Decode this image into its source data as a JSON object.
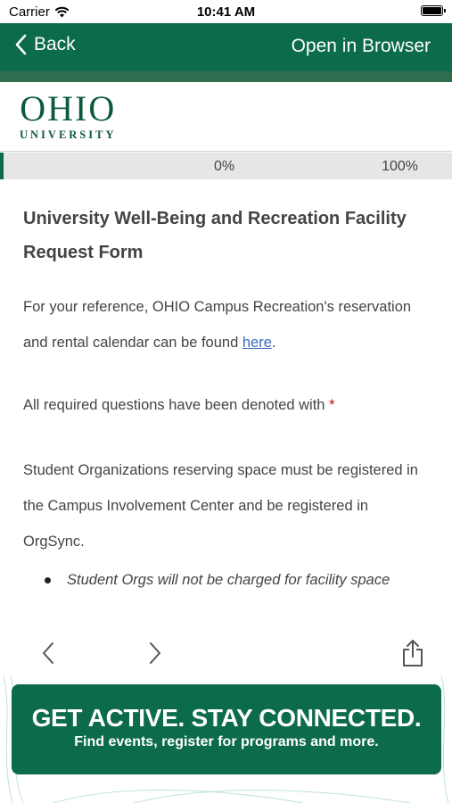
{
  "status": {
    "carrier": "Carrier",
    "time": "10:41 AM"
  },
  "nav": {
    "back_label": "Back",
    "open_browser_label": "Open in Browser"
  },
  "logo": {
    "main": "OHIO",
    "sub": "UNIVERSITY"
  },
  "progress": {
    "start_label": "0%",
    "end_label": "100%",
    "value": 0
  },
  "content": {
    "title": "University Well-Being and Recreation Facility Request Form",
    "reference_text": "For your reference, OHIO Campus Recreation's reservation and rental calendar can be found ",
    "reference_link": "here",
    "reference_end": ".",
    "required_text": "All required questions have been denoted with ",
    "required_mark": "*",
    "student_orgs_text": "Student Organizations reserving space must be registered in the Campus Involvement Center and be registered in OrgSync.",
    "bullet_text": "Student Orgs will not be charged for facility space"
  },
  "banner": {
    "title": "GET ACTIVE.  STAY CONNECTED.",
    "subtitle": "Find events, register for programs and more."
  },
  "colors": {
    "brand_green": "#0c6b4a",
    "link": "#3a6cc0",
    "required": "#d0021b"
  },
  "icons": [
    "wifi-icon",
    "battery-icon",
    "chevron-left-icon",
    "chevron-right-icon",
    "share-icon"
  ]
}
